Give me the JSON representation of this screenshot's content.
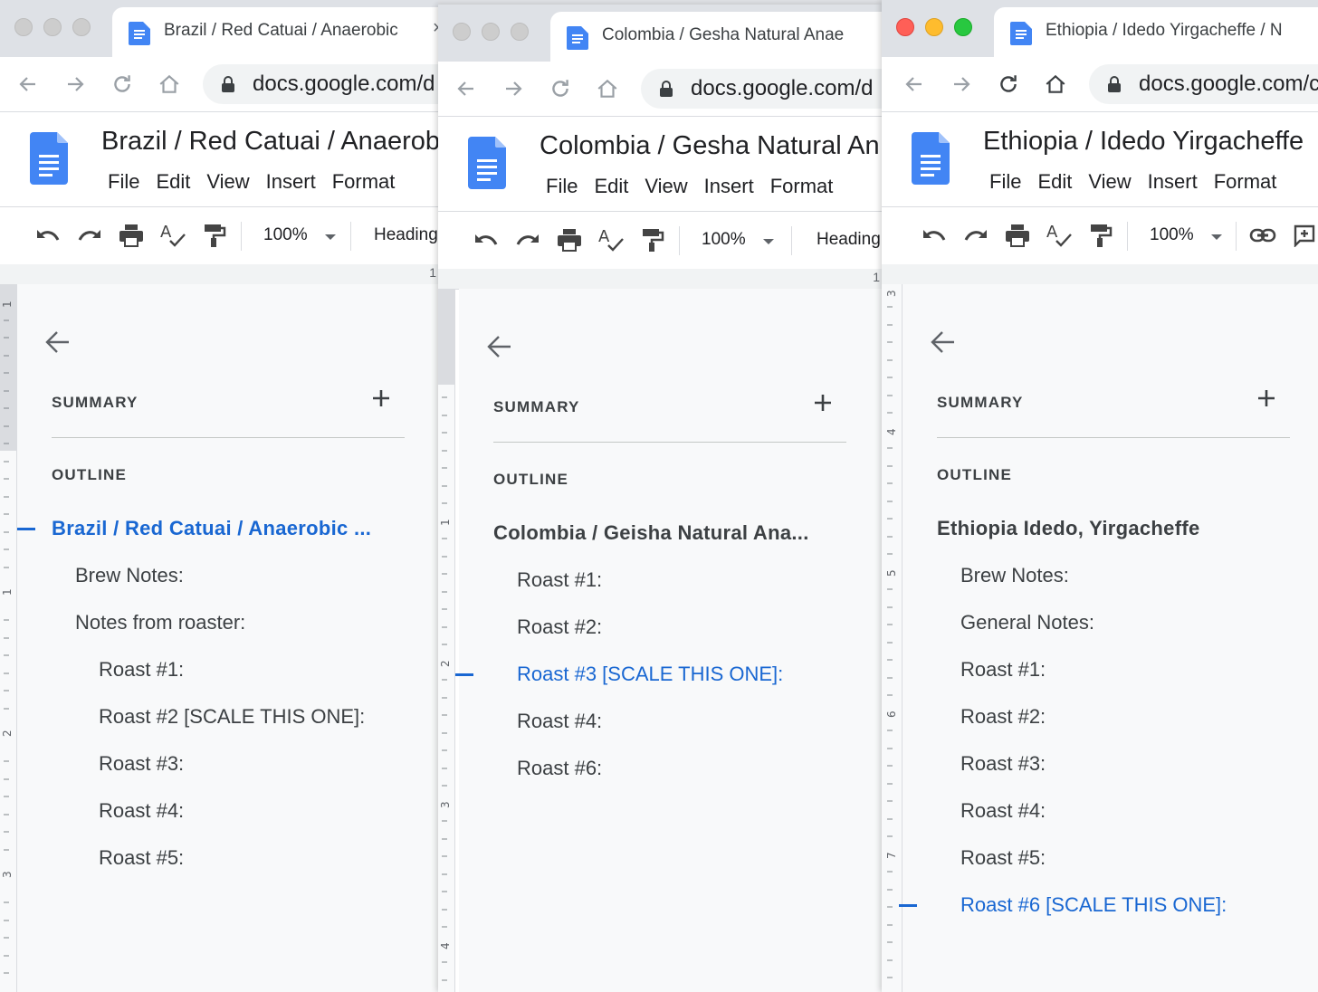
{
  "colors": {
    "accent": "#1967d2",
    "text": "#3c4043",
    "panel_bg": "#f8f9fa",
    "docs_blue": "#4285f4"
  },
  "icons": {
    "back": "arrow-left-icon",
    "forward": "arrow-right-icon",
    "reload": "reload-icon",
    "home": "home-icon",
    "lock": "lock-icon",
    "undo": "undo-icon",
    "redo": "redo-icon",
    "print": "print-icon",
    "spellcheck": "spellcheck-icon",
    "paint_format": "paint-format-icon",
    "link": "link-icon",
    "comment": "add-comment-icon"
  },
  "windows": [
    {
      "tab_title": "Brazil / Red Catuai / Anaerobic",
      "tab_close": "×",
      "url": "docs.google.com/d",
      "doc_title": "Brazil / Red Catuai / Anaerobi",
      "menu": [
        "File",
        "Edit",
        "View",
        "Insert",
        "Format"
      ],
      "zoom": "100%",
      "style": "Heading",
      "ruler_top": "1",
      "ruler_side": [
        "1",
        "1",
        "2",
        "3"
      ],
      "panel": {
        "summary": "SUMMARY",
        "plus": "+",
        "outline": "OUTLINE"
      },
      "outline_items": [
        {
          "text": "Brazil / Red Catuai / Anaerobic ...",
          "level": 0,
          "active": true
        },
        {
          "text": "Brew Notes:",
          "level": 1,
          "active": false
        },
        {
          "text": "Notes from roaster:",
          "level": 1,
          "active": false
        },
        {
          "text": "Roast #1:",
          "level": 2,
          "active": false
        },
        {
          "text": "Roast #2 [SCALE THIS ONE]:",
          "level": 2,
          "active": false
        },
        {
          "text": "Roast #3:",
          "level": 2,
          "active": false
        },
        {
          "text": "Roast #4:",
          "level": 2,
          "active": false
        },
        {
          "text": "Roast #5:",
          "level": 2,
          "active": false
        }
      ]
    },
    {
      "tab_title": "Colombia / Gesha Natural Anae",
      "tab_close": "",
      "url": "docs.google.com/d",
      "doc_title": "Colombia / Gesha Natural An",
      "menu": [
        "File",
        "Edit",
        "View",
        "Insert",
        "Format"
      ],
      "zoom": "100%",
      "style": "Heading",
      "ruler_top": "1",
      "ruler_side": [
        "1",
        "2",
        "3",
        "4"
      ],
      "panel": {
        "summary": "SUMMARY",
        "plus": "+",
        "outline": "OUTLINE"
      },
      "outline_items": [
        {
          "text": "Colombia / Geisha Natural Ana...",
          "level": 0,
          "active": false
        },
        {
          "text": "Roast #1:",
          "level": 1,
          "active": false
        },
        {
          "text": "Roast #2:",
          "level": 1,
          "active": false
        },
        {
          "text": "Roast #3 [SCALE THIS ONE]:",
          "level": 1,
          "active": true
        },
        {
          "text": "Roast #4:",
          "level": 1,
          "active": false
        },
        {
          "text": "Roast #6:",
          "level": 1,
          "active": false
        }
      ]
    },
    {
      "tab_title": "Ethiopia / Idedo Yirgacheffe / N",
      "tab_close": "",
      "url": "docs.google.com/c",
      "doc_title": "Ethiopia / Idedo Yirgacheffe",
      "menu": [
        "File",
        "Edit",
        "View",
        "Insert",
        "Format"
      ],
      "zoom": "100%",
      "style": "",
      "ruler_top": "",
      "ruler_side": [
        "3",
        "4",
        "5",
        "6",
        "7"
      ],
      "panel": {
        "summary": "SUMMARY",
        "plus": "+",
        "outline": "OUTLINE"
      },
      "outline_items": [
        {
          "text": "Ethiopia Idedo, Yirgacheffe",
          "level": 0,
          "active": false
        },
        {
          "text": "Brew Notes:",
          "level": 1,
          "active": false
        },
        {
          "text": "General Notes:",
          "level": 1,
          "active": false
        },
        {
          "text": "Roast #1:",
          "level": 1,
          "active": false
        },
        {
          "text": "Roast #2:",
          "level": 1,
          "active": false
        },
        {
          "text": "Roast #3:",
          "level": 1,
          "active": false
        },
        {
          "text": "Roast #4:",
          "level": 1,
          "active": false
        },
        {
          "text": "Roast #5:",
          "level": 1,
          "active": false
        },
        {
          "text": "Roast #6 [SCALE THIS ONE]:",
          "level": 1,
          "active": true
        }
      ]
    }
  ]
}
